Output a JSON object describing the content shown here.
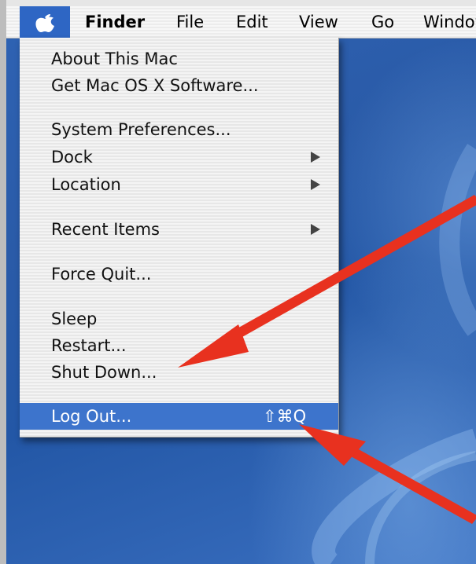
{
  "menubar": {
    "app_name": "Finder",
    "items": [
      "File",
      "Edit",
      "View",
      "Go",
      "Window"
    ]
  },
  "apple_menu": {
    "items": [
      {
        "label": "About This Mac"
      },
      {
        "label": "Get Mac OS X Software..."
      },
      {
        "label": "System Preferences..."
      },
      {
        "label": "Dock",
        "submenu": true
      },
      {
        "label": "Location",
        "submenu": true
      },
      {
        "label": "Recent Items",
        "submenu": true
      },
      {
        "label": "Force Quit..."
      },
      {
        "label": "Sleep"
      },
      {
        "label": "Restart..."
      },
      {
        "label": "Shut Down..."
      },
      {
        "label": "Log Out...",
        "shortcut": "⇧⌘Q",
        "highlighted": true
      }
    ]
  },
  "colors": {
    "highlight": "#3d74cc",
    "annotation_arrow": "#e8311f",
    "desktop": "#2a5ba8"
  },
  "icons": [
    "apple-logo-icon",
    "submenu-arrow-icon"
  ]
}
